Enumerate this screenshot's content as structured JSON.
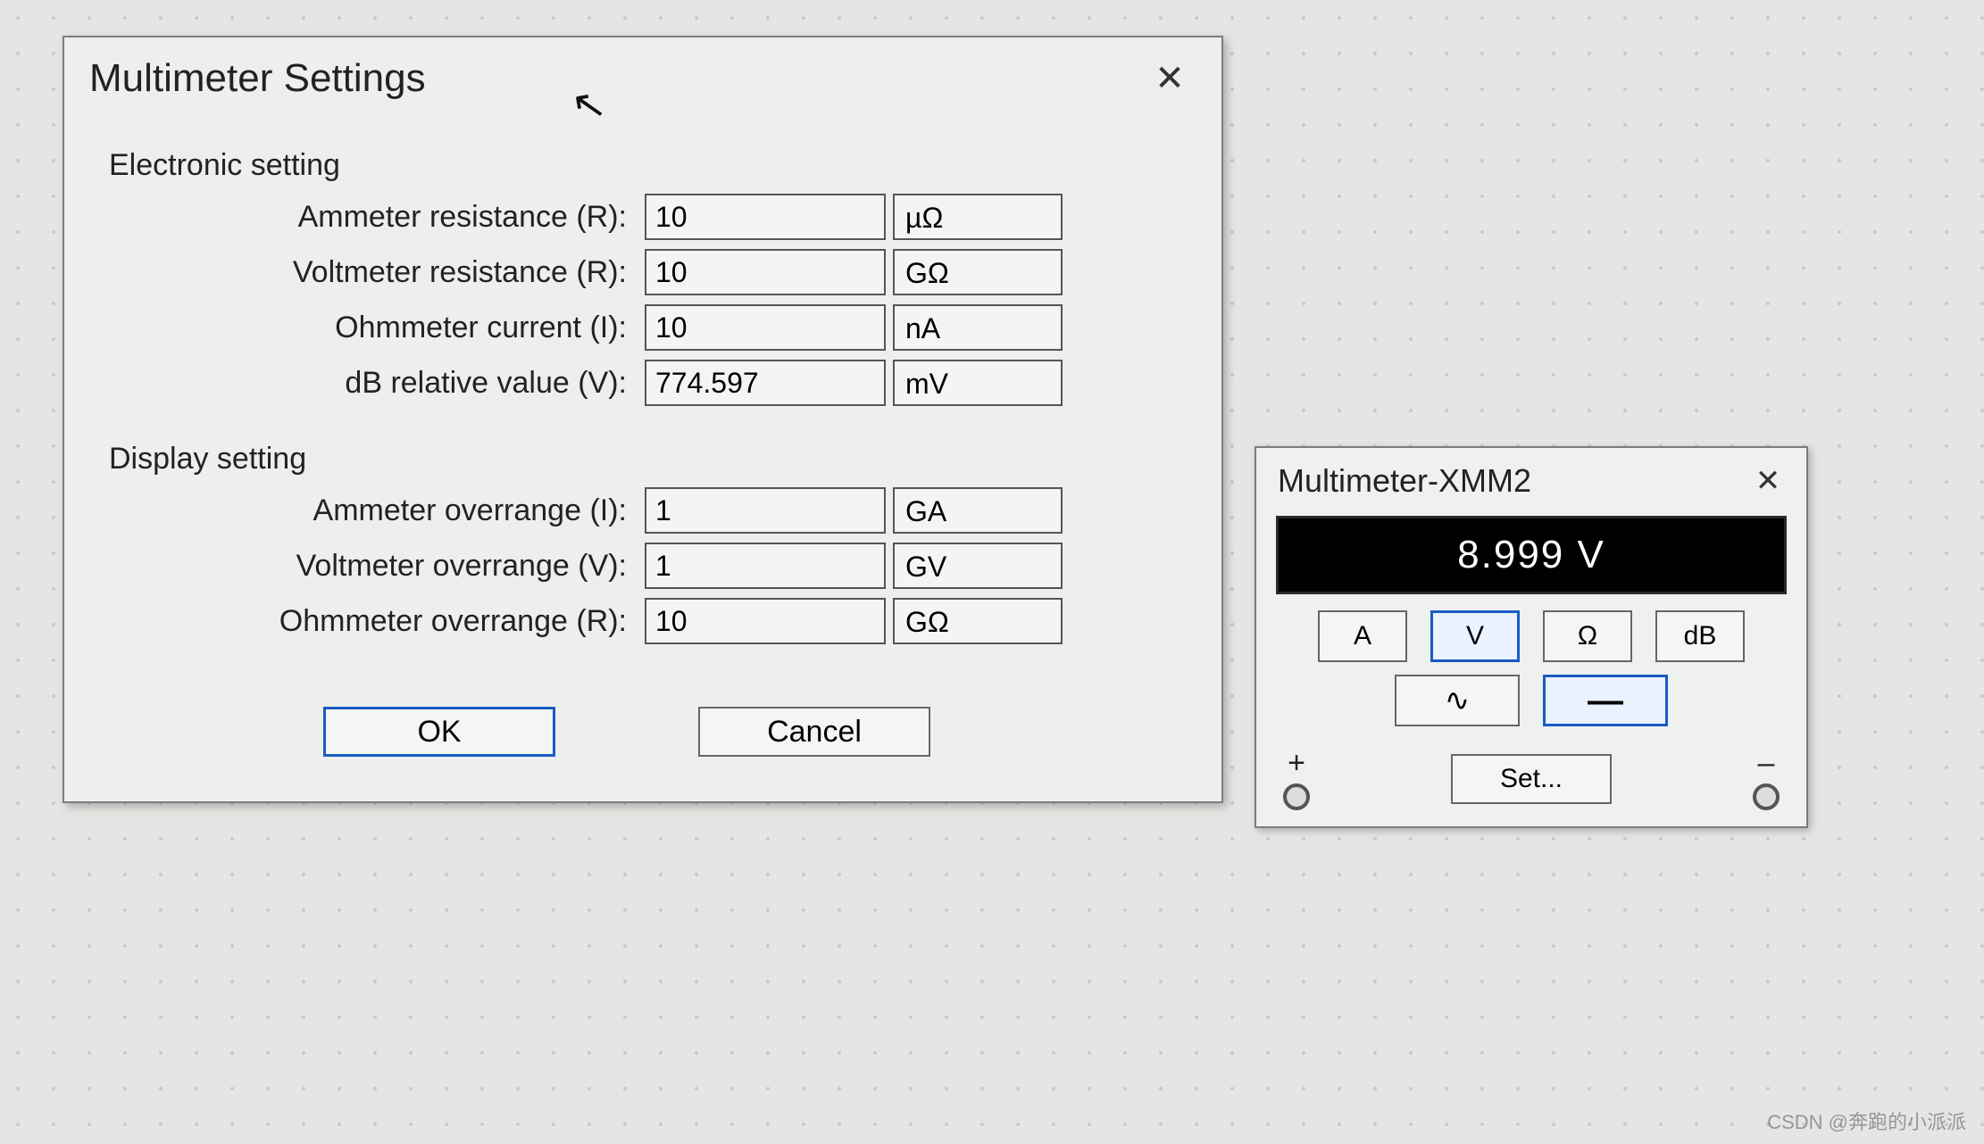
{
  "settings_dialog": {
    "title": "Multimeter Settings",
    "electronic": {
      "title": "Electronic setting",
      "rows": [
        {
          "label": "Ammeter resistance (R):",
          "value": "10",
          "unit": "µΩ"
        },
        {
          "label": "Voltmeter resistance (R):",
          "value": "10",
          "unit": "GΩ"
        },
        {
          "label": "Ohmmeter current (I):",
          "value": "10",
          "unit": "nA"
        },
        {
          "label": "dB relative value (V):",
          "value": "774.597",
          "unit": "mV"
        }
      ]
    },
    "display": {
      "title": "Display setting",
      "rows": [
        {
          "label": "Ammeter overrange (I):",
          "value": "1",
          "unit": "GA"
        },
        {
          "label": "Voltmeter overrange (V):",
          "value": "1",
          "unit": "GV"
        },
        {
          "label": "Ohmmeter overrange (R):",
          "value": "10",
          "unit": "GΩ"
        }
      ]
    },
    "buttons": {
      "ok": "OK",
      "cancel": "Cancel"
    }
  },
  "meter": {
    "title": "Multimeter-XMM2",
    "reading": "8.999 V",
    "modes": {
      "A": "A",
      "V": "V",
      "Ohm": "Ω",
      "dB": "dB",
      "selected": "V"
    },
    "wave": {
      "ac": "∿",
      "dc": "—",
      "selected": "dc"
    },
    "terminals": {
      "plus": "+",
      "minus": "–"
    },
    "set": "Set..."
  },
  "watermark": "CSDN @奔跑的小派派"
}
